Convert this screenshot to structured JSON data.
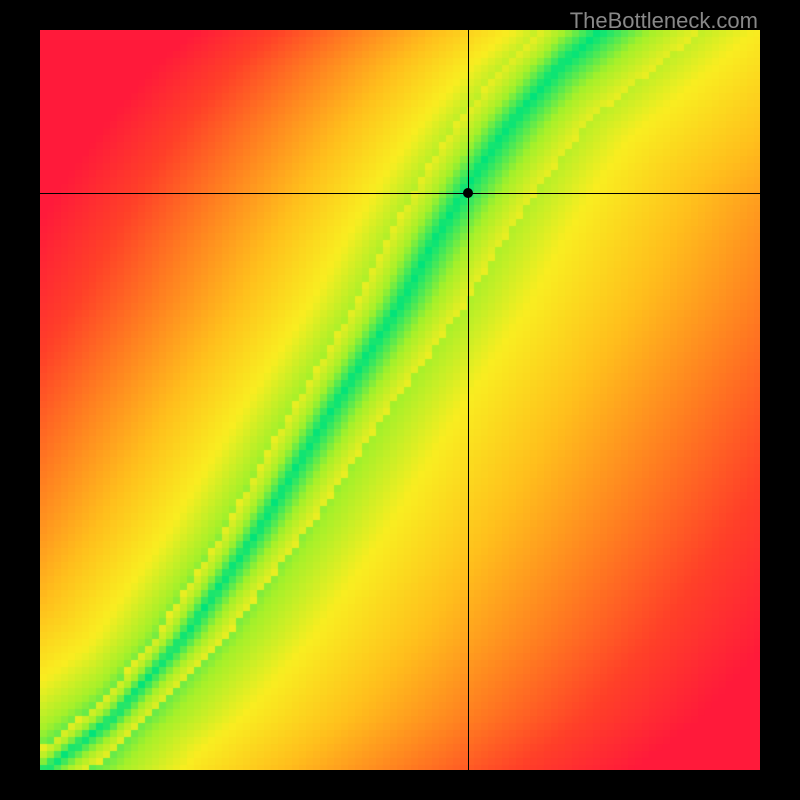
{
  "watermark": "TheBottleneck.com",
  "chart_data": {
    "type": "heatmap",
    "xlim": [
      0,
      1
    ],
    "ylim": [
      0,
      1
    ],
    "crosshair": {
      "x": 0.595,
      "y": 0.78
    },
    "marker": {
      "x": 0.595,
      "y": 0.78
    },
    "optimal_curve_note": "Green ridge is a convex increasing curve from bottom-left to top-right; color gradient is red→orange→yellow→green by distance from the ridge (green = optimal, red = far).",
    "optimal_curve_samples": [
      {
        "x": 0.02,
        "y": 0.01
      },
      {
        "x": 0.1,
        "y": 0.07
      },
      {
        "x": 0.2,
        "y": 0.18
      },
      {
        "x": 0.3,
        "y": 0.32
      },
      {
        "x": 0.4,
        "y": 0.48
      },
      {
        "x": 0.5,
        "y": 0.63
      },
      {
        "x": 0.55,
        "y": 0.72
      },
      {
        "x": 0.6,
        "y": 0.8
      },
      {
        "x": 0.65,
        "y": 0.87
      },
      {
        "x": 0.72,
        "y": 0.95
      },
      {
        "x": 0.78,
        "y": 1.0
      }
    ],
    "color_stops": [
      {
        "t": 0.0,
        "color": "#00e37a"
      },
      {
        "t": 0.1,
        "color": "#a4f02a"
      },
      {
        "t": 0.22,
        "color": "#f9ed20"
      },
      {
        "t": 0.4,
        "color": "#ffbf1c"
      },
      {
        "t": 0.6,
        "color": "#ff8020"
      },
      {
        "t": 0.8,
        "color": "#ff4028"
      },
      {
        "t": 1.0,
        "color": "#ff1a3a"
      }
    ]
  }
}
